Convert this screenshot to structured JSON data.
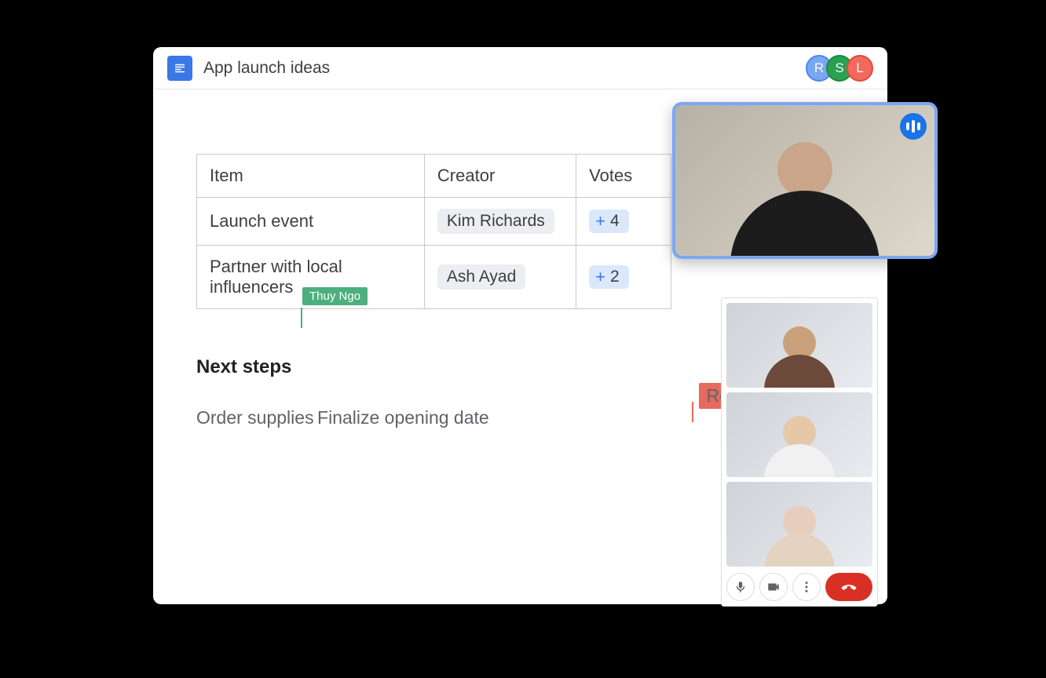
{
  "header": {
    "doc_title": "App launch ideas",
    "presence": [
      {
        "initial": "R",
        "color": "r"
      },
      {
        "initial": "S",
        "color": "s"
      },
      {
        "initial": "L",
        "color": "l"
      }
    ]
  },
  "table": {
    "columns": [
      "Item",
      "Creator",
      "Votes"
    ],
    "rows": [
      {
        "item": "Launch event",
        "creator": "Kim Richards",
        "votes": 4
      },
      {
        "item": "Partner with local influencers",
        "creator": "Ash Ayad",
        "votes": 2
      }
    ]
  },
  "next_steps": {
    "heading": "Next steps",
    "items": [
      "Order supplies",
      "Finalize opening date"
    ]
  },
  "collab_cursors": {
    "cursor1": {
      "name": "Thuy Ngo",
      "color": "green",
      "anchor": "heading_end"
    },
    "cursor2": {
      "name": "Ronald Das",
      "color": "red",
      "anchor": "step2_end"
    }
  },
  "meet": {
    "participants": [
      {
        "id": "p1",
        "label": "participant-1"
      },
      {
        "id": "p2",
        "label": "participant-2"
      },
      {
        "id": "p3",
        "label": "participant-3"
      }
    ],
    "active_speaker": {
      "label": "active-speaker"
    },
    "controls": {
      "mic": "microphone",
      "camera": "camera",
      "more": "more-options",
      "hangup": "hang-up"
    }
  }
}
